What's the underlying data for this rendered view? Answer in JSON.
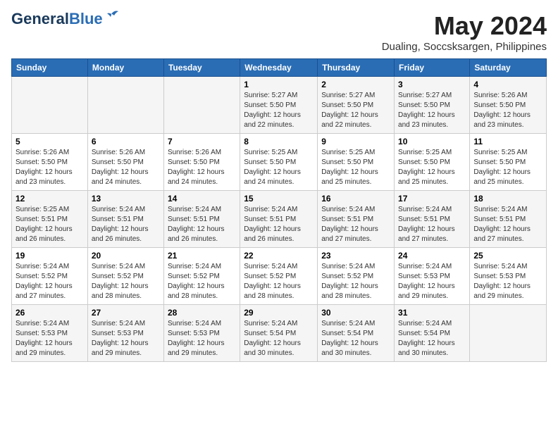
{
  "logo": {
    "text1": "General",
    "text2": "Blue"
  },
  "title": "May 2024",
  "subtitle": "Dualing, Soccsksargen, Philippines",
  "days_of_week": [
    "Sunday",
    "Monday",
    "Tuesday",
    "Wednesday",
    "Thursday",
    "Friday",
    "Saturday"
  ],
  "weeks": [
    [
      {
        "day": "",
        "info": ""
      },
      {
        "day": "",
        "info": ""
      },
      {
        "day": "",
        "info": ""
      },
      {
        "day": "1",
        "info": "Sunrise: 5:27 AM\nSunset: 5:50 PM\nDaylight: 12 hours\nand 22 minutes."
      },
      {
        "day": "2",
        "info": "Sunrise: 5:27 AM\nSunset: 5:50 PM\nDaylight: 12 hours\nand 22 minutes."
      },
      {
        "day": "3",
        "info": "Sunrise: 5:27 AM\nSunset: 5:50 PM\nDaylight: 12 hours\nand 23 minutes."
      },
      {
        "day": "4",
        "info": "Sunrise: 5:26 AM\nSunset: 5:50 PM\nDaylight: 12 hours\nand 23 minutes."
      }
    ],
    [
      {
        "day": "5",
        "info": "Sunrise: 5:26 AM\nSunset: 5:50 PM\nDaylight: 12 hours\nand 23 minutes."
      },
      {
        "day": "6",
        "info": "Sunrise: 5:26 AM\nSunset: 5:50 PM\nDaylight: 12 hours\nand 24 minutes."
      },
      {
        "day": "7",
        "info": "Sunrise: 5:26 AM\nSunset: 5:50 PM\nDaylight: 12 hours\nand 24 minutes."
      },
      {
        "day": "8",
        "info": "Sunrise: 5:25 AM\nSunset: 5:50 PM\nDaylight: 12 hours\nand 24 minutes."
      },
      {
        "day": "9",
        "info": "Sunrise: 5:25 AM\nSunset: 5:50 PM\nDaylight: 12 hours\nand 25 minutes."
      },
      {
        "day": "10",
        "info": "Sunrise: 5:25 AM\nSunset: 5:50 PM\nDaylight: 12 hours\nand 25 minutes."
      },
      {
        "day": "11",
        "info": "Sunrise: 5:25 AM\nSunset: 5:50 PM\nDaylight: 12 hours\nand 25 minutes."
      }
    ],
    [
      {
        "day": "12",
        "info": "Sunrise: 5:25 AM\nSunset: 5:51 PM\nDaylight: 12 hours\nand 26 minutes."
      },
      {
        "day": "13",
        "info": "Sunrise: 5:24 AM\nSunset: 5:51 PM\nDaylight: 12 hours\nand 26 minutes."
      },
      {
        "day": "14",
        "info": "Sunrise: 5:24 AM\nSunset: 5:51 PM\nDaylight: 12 hours\nand 26 minutes."
      },
      {
        "day": "15",
        "info": "Sunrise: 5:24 AM\nSunset: 5:51 PM\nDaylight: 12 hours\nand 26 minutes."
      },
      {
        "day": "16",
        "info": "Sunrise: 5:24 AM\nSunset: 5:51 PM\nDaylight: 12 hours\nand 27 minutes."
      },
      {
        "day": "17",
        "info": "Sunrise: 5:24 AM\nSunset: 5:51 PM\nDaylight: 12 hours\nand 27 minutes."
      },
      {
        "day": "18",
        "info": "Sunrise: 5:24 AM\nSunset: 5:51 PM\nDaylight: 12 hours\nand 27 minutes."
      }
    ],
    [
      {
        "day": "19",
        "info": "Sunrise: 5:24 AM\nSunset: 5:52 PM\nDaylight: 12 hours\nand 27 minutes."
      },
      {
        "day": "20",
        "info": "Sunrise: 5:24 AM\nSunset: 5:52 PM\nDaylight: 12 hours\nand 28 minutes."
      },
      {
        "day": "21",
        "info": "Sunrise: 5:24 AM\nSunset: 5:52 PM\nDaylight: 12 hours\nand 28 minutes."
      },
      {
        "day": "22",
        "info": "Sunrise: 5:24 AM\nSunset: 5:52 PM\nDaylight: 12 hours\nand 28 minutes."
      },
      {
        "day": "23",
        "info": "Sunrise: 5:24 AM\nSunset: 5:52 PM\nDaylight: 12 hours\nand 28 minutes."
      },
      {
        "day": "24",
        "info": "Sunrise: 5:24 AM\nSunset: 5:53 PM\nDaylight: 12 hours\nand 29 minutes."
      },
      {
        "day": "25",
        "info": "Sunrise: 5:24 AM\nSunset: 5:53 PM\nDaylight: 12 hours\nand 29 minutes."
      }
    ],
    [
      {
        "day": "26",
        "info": "Sunrise: 5:24 AM\nSunset: 5:53 PM\nDaylight: 12 hours\nand 29 minutes."
      },
      {
        "day": "27",
        "info": "Sunrise: 5:24 AM\nSunset: 5:53 PM\nDaylight: 12 hours\nand 29 minutes."
      },
      {
        "day": "28",
        "info": "Sunrise: 5:24 AM\nSunset: 5:53 PM\nDaylight: 12 hours\nand 29 minutes."
      },
      {
        "day": "29",
        "info": "Sunrise: 5:24 AM\nSunset: 5:54 PM\nDaylight: 12 hours\nand 30 minutes."
      },
      {
        "day": "30",
        "info": "Sunrise: 5:24 AM\nSunset: 5:54 PM\nDaylight: 12 hours\nand 30 minutes."
      },
      {
        "day": "31",
        "info": "Sunrise: 5:24 AM\nSunset: 5:54 PM\nDaylight: 12 hours\nand 30 minutes."
      },
      {
        "day": "",
        "info": ""
      }
    ]
  ]
}
